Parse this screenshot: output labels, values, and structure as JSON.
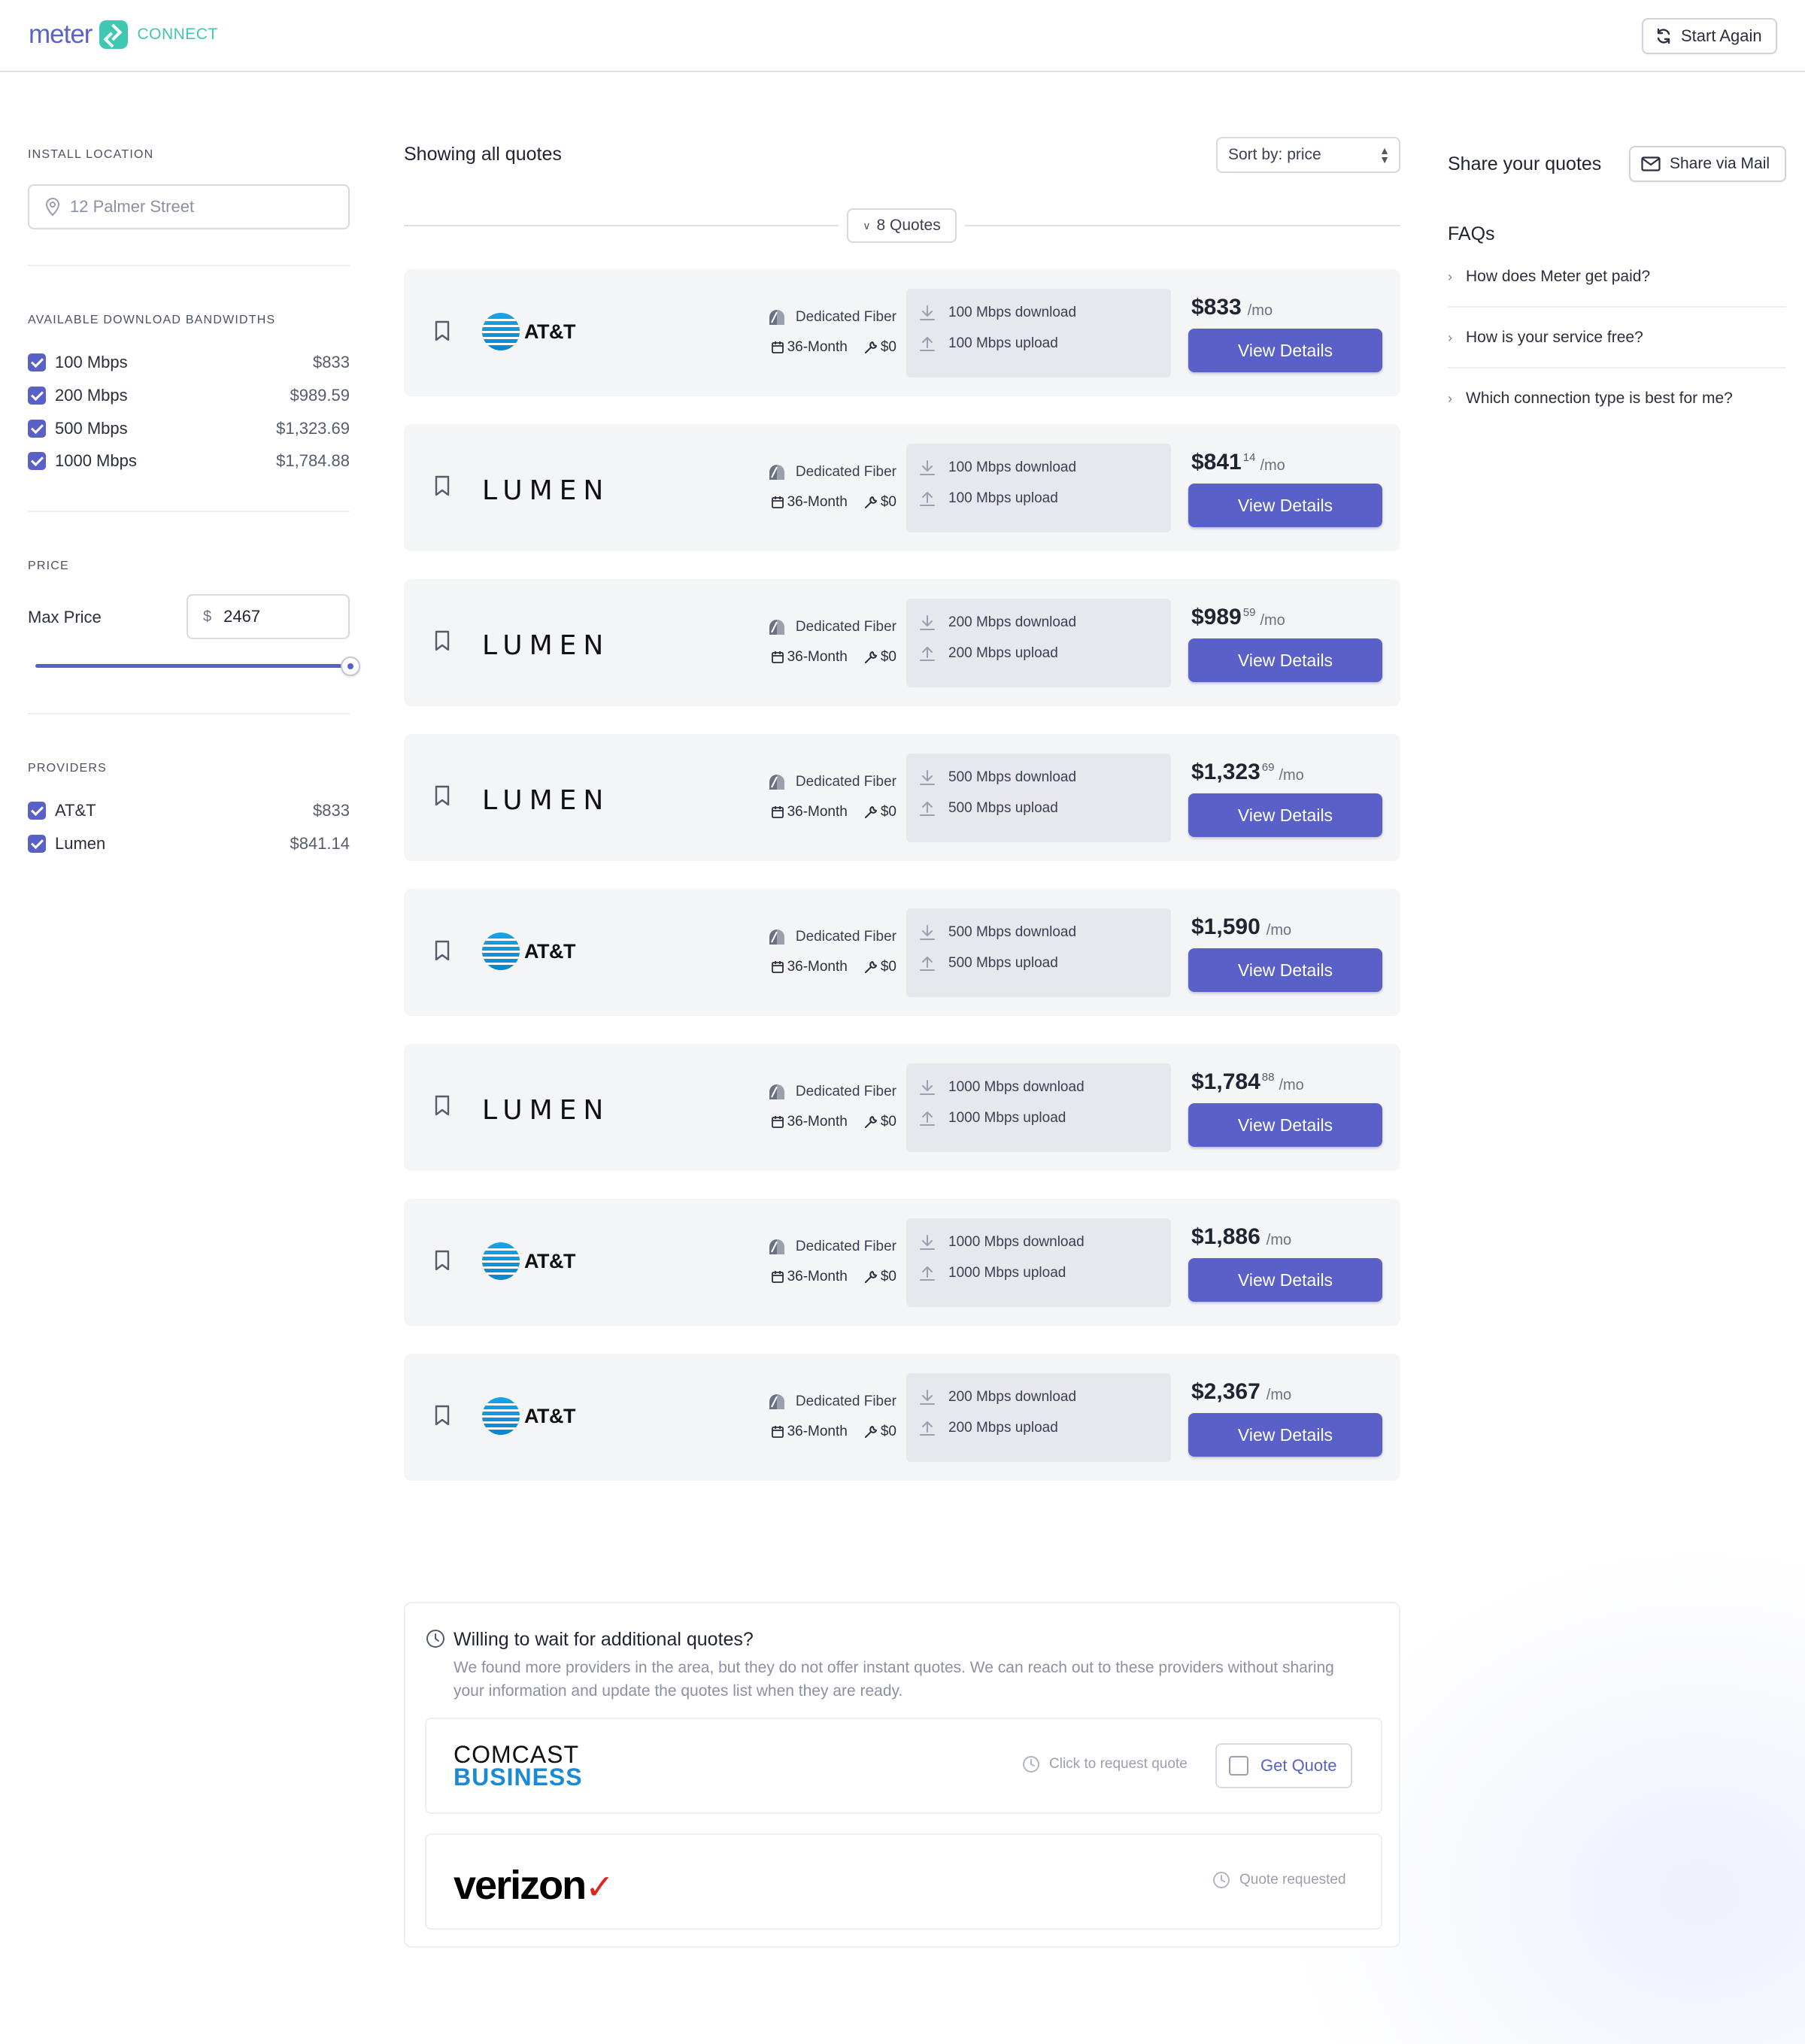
{
  "header": {
    "brand": "meter",
    "product": "CONNECT",
    "start_again": "Start Again"
  },
  "sidebar": {
    "install_location_label": "INSTALL LOCATION",
    "install_location_placeholder": "12 Palmer Street",
    "bandwidths_label": "AVAILABLE DOWNLOAD BANDWIDTHS",
    "bandwidths": [
      {
        "label": "100 Mbps",
        "price": "$833",
        "checked": true
      },
      {
        "label": "200 Mbps",
        "price": "$989.59",
        "checked": true
      },
      {
        "label": "500 Mbps",
        "price": "$1,323.69",
        "checked": true
      },
      {
        "label": "1000 Mbps",
        "price": "$1,784.88",
        "checked": true
      }
    ],
    "price_label": "PRICE",
    "max_price_label": "Max Price",
    "currency": "$",
    "max_price_value": "2467",
    "slider_fraction": 1.0,
    "providers_label": "PROVIDERS",
    "providers": [
      {
        "label": "AT&T",
        "price": "$833",
        "checked": true
      },
      {
        "label": "Lumen",
        "price": "$841.14",
        "checked": true
      }
    ]
  },
  "main": {
    "showing": "Showing all quotes",
    "sort": "Sort by: price",
    "quotes_count": "8 Quotes",
    "quotes": [
      {
        "provider": "AT&T",
        "logo": "att",
        "type": "Dedicated Fiber",
        "term": "36-Month",
        "install": "$0",
        "download": "100 Mbps download",
        "upload": "100 Mbps upload",
        "price": "$833",
        "cents": "",
        "per": "/mo",
        "button": "View Details"
      },
      {
        "provider": "LUMEN",
        "logo": "lumen",
        "type": "Dedicated Fiber",
        "term": "36-Month",
        "install": "$0",
        "download": "100 Mbps download",
        "upload": "100 Mbps upload",
        "price": "$841",
        "cents": "14",
        "per": "/mo",
        "button": "View Details"
      },
      {
        "provider": "LUMEN",
        "logo": "lumen",
        "type": "Dedicated Fiber",
        "term": "36-Month",
        "install": "$0",
        "download": "200 Mbps download",
        "upload": "200 Mbps upload",
        "price": "$989",
        "cents": "59",
        "per": "/mo",
        "button": "View Details"
      },
      {
        "provider": "LUMEN",
        "logo": "lumen",
        "type": "Dedicated Fiber",
        "term": "36-Month",
        "install": "$0",
        "download": "500 Mbps download",
        "upload": "500 Mbps upload",
        "price": "$1,323",
        "cents": "69",
        "per": "/mo",
        "button": "View Details"
      },
      {
        "provider": "AT&T",
        "logo": "att",
        "type": "Dedicated Fiber",
        "term": "36-Month",
        "install": "$0",
        "download": "500 Mbps download",
        "upload": "500 Mbps upload",
        "price": "$1,590",
        "cents": "",
        "per": "/mo",
        "button": "View Details"
      },
      {
        "provider": "LUMEN",
        "logo": "lumen",
        "type": "Dedicated Fiber",
        "term": "36-Month",
        "install": "$0",
        "download": "1000 Mbps download",
        "upload": "1000 Mbps upload",
        "price": "$1,784",
        "cents": "88",
        "per": "/mo",
        "button": "View Details"
      },
      {
        "provider": "AT&T",
        "logo": "att",
        "type": "Dedicated Fiber",
        "term": "36-Month",
        "install": "$0",
        "download": "1000 Mbps download",
        "upload": "1000 Mbps upload",
        "price": "$1,886",
        "cents": "",
        "per": "/mo",
        "button": "View Details"
      },
      {
        "provider": "AT&T",
        "logo": "att",
        "type": "Dedicated Fiber",
        "term": "36-Month",
        "install": "$0",
        "download": "200 Mbps download",
        "upload": "200 Mbps upload",
        "price": "$2,367",
        "cents": "",
        "per": "/mo",
        "button": "View Details"
      }
    ]
  },
  "right": {
    "share_title": "Share your quotes",
    "share_button": "Share via Mail",
    "faq_title": "FAQs",
    "faqs": [
      "How does Meter get paid?",
      "How is your service free?",
      "Which connection type is best for me?"
    ]
  },
  "additional": {
    "title": "Willing to wait for additional quotes?",
    "description": "We found more providers in the area, but they do not offer instant quotes. We can reach out to these providers without sharing your information and update the quotes list when they are ready.",
    "comcast_line1": "COMCAST",
    "comcast_line2": "BUSINESS",
    "comcast_note": "Click to request quote",
    "get_quote": "Get Quote",
    "verizon_logo": "verizon",
    "verizon_note": "Quote requested"
  },
  "colors": {
    "accent": "#5960c7",
    "brand_teal": "#3fc7b1",
    "card_bg": "#f4f5f7",
    "speed_bg": "#e6e8ee"
  }
}
